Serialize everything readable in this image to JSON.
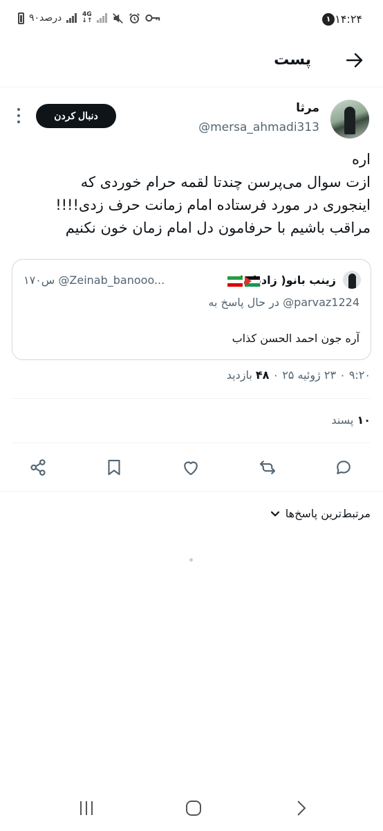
{
  "status_bar": {
    "time": "۱۴:۲۴",
    "notification_count": "۱",
    "battery_text": "۹۰درصد",
    "network_type": "4G",
    "icons": [
      "battery-icon",
      "signal-icon",
      "network-icon",
      "wifi-signal-icon",
      "mute-icon",
      "alarm-icon",
      "key-icon"
    ]
  },
  "header": {
    "title": "پست",
    "back_icon": "arrow-right-icon"
  },
  "author": {
    "name": "مرثا",
    "handle": "@mersa_ahmadi313",
    "follow_label": "دنبال کردن"
  },
  "tweet": {
    "lines": [
      "اره",
      "ازت سوال می‌پرسن چندتا لقمه حرام خوردی که",
      "اینجوری در مورد فرستاده امام زمانت حرف زدی!!!!",
      "مراقب باشیم با حرفامون دل امام زمان خون نکنیم"
    ]
  },
  "quote": {
    "name": "زینب بانو( زادیان)",
    "handle": "@Zeinab_banooo...",
    "time": "۱۷۰س",
    "reply_prefix": "در حال پاسخ به",
    "reply_mention": "@parvaz1224",
    "text": "آره جون احمد الحسن کذاب"
  },
  "meta": {
    "time_date": "۹:۲۰ ۰ ۲۳ ژوئیه ۲۵ ۰",
    "views": "۴۸",
    "views_label": "بازدید"
  },
  "likes": {
    "count": "۱۰",
    "label": "پسند"
  },
  "actions": [
    "reply-icon",
    "retweet-icon",
    "like-icon",
    "bookmark-icon",
    "share-icon"
  ],
  "replies_sort": {
    "label": "مرتبط‌ترین پاسخ‌ها"
  },
  "nav": [
    "recents-icon",
    "home-icon",
    "back-icon"
  ]
}
